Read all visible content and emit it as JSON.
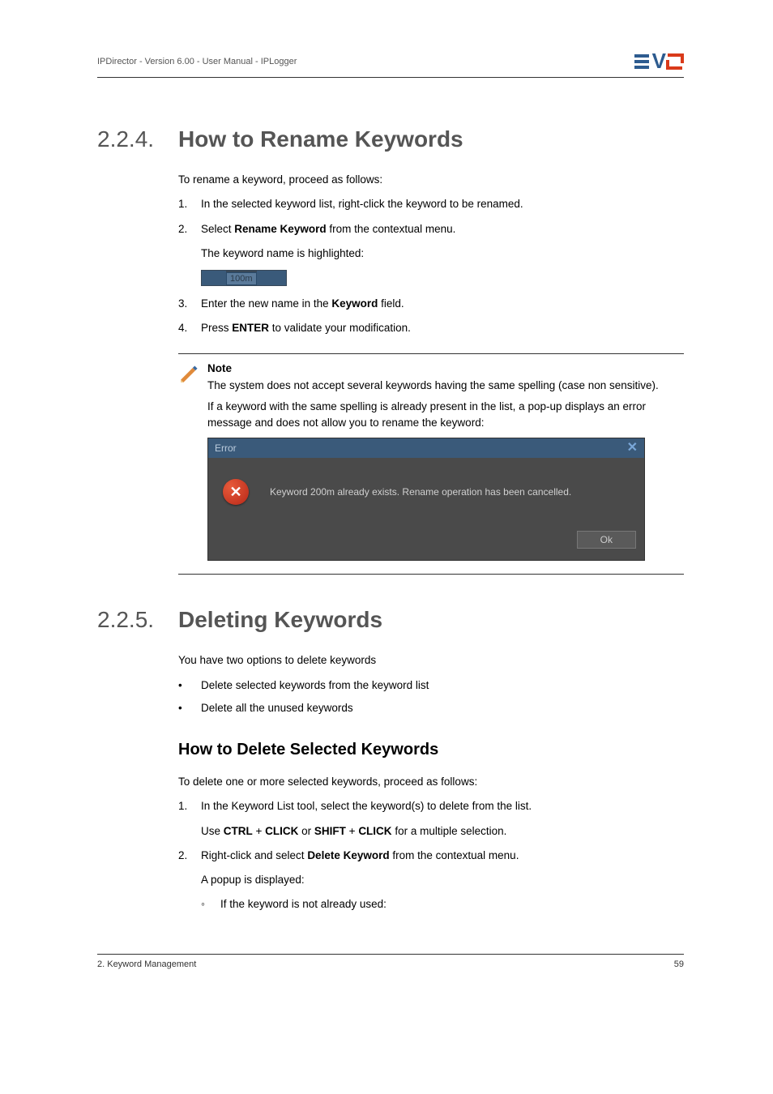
{
  "header": {
    "text": "IPDirector - Version 6.00 - User Manual - IPLogger"
  },
  "s1": {
    "num": "2.2.4.",
    "title": "How to Rename Keywords",
    "intro": "To rename a keyword, proceed as follows:",
    "step1": "In the selected keyword list, right-click the keyword to be renamed.",
    "step2_pre": "Select ",
    "step2_b": "Rename Keyword",
    "step2_post": " from the contextual menu.",
    "step2_sub": "The keyword name is highlighted:",
    "kw_text": "100m",
    "step3_pre": "Enter the new name in the ",
    "step3_b": "Keyword",
    "step3_post": " field.",
    "step4_pre": "Press ",
    "step4_b": "ENTER",
    "step4_post": " to validate your modification."
  },
  "note": {
    "title": "Note",
    "p1": "The system does not accept several keywords having the same spelling (case non sensitive).",
    "p2": "If a keyword with the same spelling is already present in the list, a pop-up displays an error message and does not allow you to rename the keyword:"
  },
  "error": {
    "title": "Error",
    "close": "✕",
    "x": "✕",
    "msg": "Keyword 200m already exists. Rename operation has been cancelled.",
    "ok": "Ok"
  },
  "s2": {
    "num": "2.2.5.",
    "title": "Deleting Keywords",
    "intro": "You have two options to delete keywords",
    "b1": "Delete selected keywords from the keyword list",
    "b2": "Delete all the unused keywords",
    "subtitle": "How to Delete Selected Keywords",
    "subintro": "To delete one or more selected keywords, proceed as follows:",
    "step1": "In the Keyword List tool, select the keyword(s) to delete from the list.",
    "step1_sub_pre": "Use ",
    "step1_sub_b1": "CTRL",
    "step1_sub_m1": " + ",
    "step1_sub_b2": "CLICK",
    "step1_sub_m2": " or ",
    "step1_sub_b3": "SHIFT",
    "step1_sub_m3": " + ",
    "step1_sub_b4": "CLICK",
    "step1_sub_post": " for a multiple selection.",
    "step2_pre": "Right-click and select ",
    "step2_b": "Delete Keyword",
    "step2_post": " from the contextual menu.",
    "step2_sub": "A popup is displayed:",
    "step2_sub1": "If the keyword is not already used:"
  },
  "footer": {
    "left": "2. Keyword Management",
    "right": "59"
  }
}
